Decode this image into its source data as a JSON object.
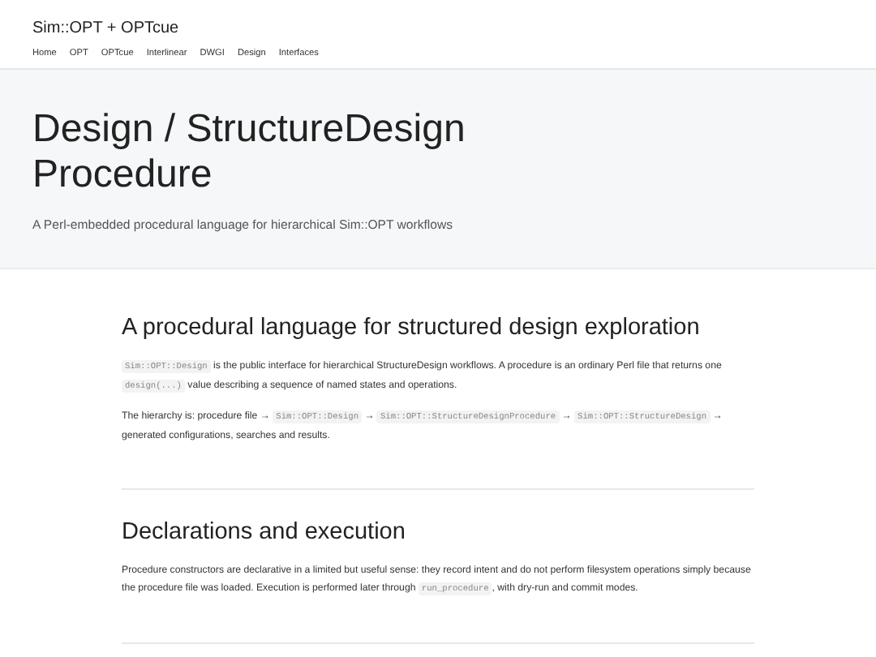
{
  "site": {
    "title": "Sim::OPT + OPTcue",
    "nav": [
      {
        "label": "Home"
      },
      {
        "label": "OPT"
      },
      {
        "label": "OPTcue"
      },
      {
        "label": "Interlinear"
      },
      {
        "label": "DWGI"
      },
      {
        "label": "Design"
      },
      {
        "label": "Interfaces"
      }
    ]
  },
  "hero": {
    "title": "Design / StructureDesign Procedure",
    "subtitle": "A Perl-embedded procedural language for hierarchical Sim::OPT workflows"
  },
  "sections": [
    {
      "heading": "A procedural language for structured design exploration",
      "paragraphs": [
        [
          {
            "kind": "code",
            "text": "Sim::OPT::Design"
          },
          {
            "kind": "text",
            "text": " is the public interface for hierarchical StructureDesign workflows. A procedure is an ordinary Perl file that returns one "
          },
          {
            "kind": "code",
            "text": "design(...)"
          },
          {
            "kind": "text",
            "text": " value describing a sequence of named states and operations."
          }
        ],
        [
          {
            "kind": "text",
            "text": "The hierarchy is: procedure file → "
          },
          {
            "kind": "code",
            "text": "Sim::OPT::Design"
          },
          {
            "kind": "text",
            "text": " → "
          },
          {
            "kind": "code",
            "text": "Sim::OPT::StructureDesignProcedure"
          },
          {
            "kind": "text",
            "text": " → "
          },
          {
            "kind": "code",
            "text": "Sim::OPT::StructureDesign"
          },
          {
            "kind": "text",
            "text": " → generated configurations, searches and results."
          }
        ]
      ]
    },
    {
      "heading": "Declarations and execution",
      "paragraphs": [
        [
          {
            "kind": "text",
            "text": "Procedure constructors are declarative in a limited but useful sense: they record intent and do not perform filesystem operations simply because the procedure file was loaded. Execution is performed later through "
          },
          {
            "kind": "code",
            "text": "run_procedure"
          },
          {
            "kind": "text",
            "text": ", with dry-run and commit modes."
          }
        ]
      ]
    }
  ]
}
